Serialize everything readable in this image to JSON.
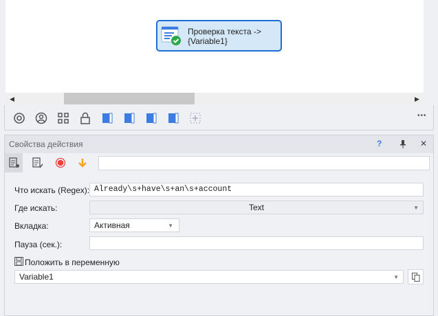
{
  "canvas": {
    "node_label_line1": "Проверка текста ->",
    "node_label_line2": "{Variable1}"
  },
  "toolbar": {
    "more": "•••"
  },
  "panel": {
    "title": "Свойства действия",
    "help": "?",
    "close": "✕",
    "search_value": "",
    "fields": {
      "regex_label": "Что искать (Regex):",
      "regex_value": "Already\\s+have\\s+an\\s+account",
      "where_label": "Где искать:",
      "where_value": "Text",
      "tab_label": "Вкладка:",
      "tab_value": "Активная",
      "pause_label": "Пауза (сек.):",
      "pause_value": "",
      "save_var_label": "Положить в переменную",
      "variable_value": "Variable1"
    }
  },
  "colors": {
    "accent": "#1c6ed6",
    "node_bg": "#d4e8f8",
    "record": "#f04040",
    "arrow": "#f5a623"
  }
}
